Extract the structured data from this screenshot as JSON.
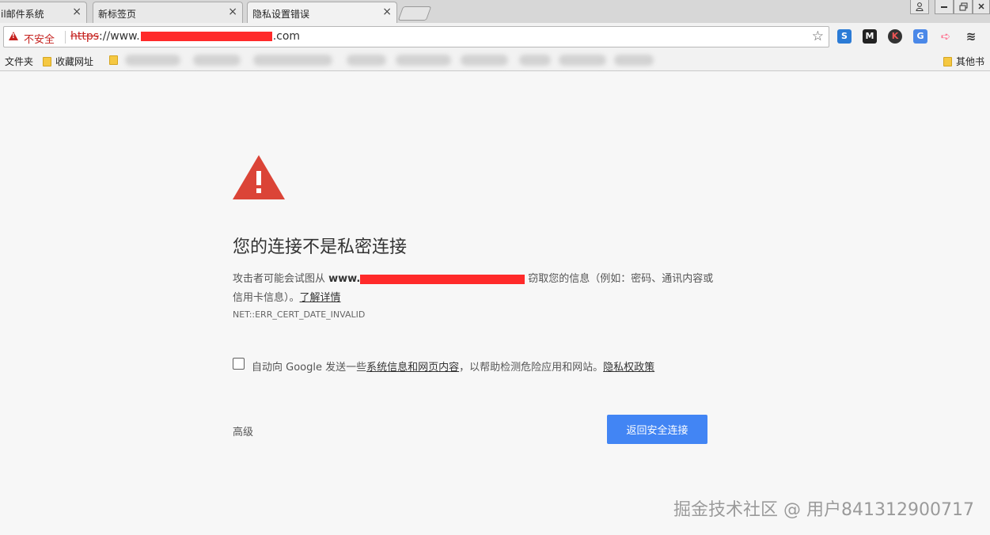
{
  "tabs": [
    {
      "title": "il邮件系统"
    },
    {
      "title": "新标签页"
    },
    {
      "title": "隐私设置错误"
    }
  ],
  "close_glyph": "×",
  "address_bar": {
    "security_label": "不安全",
    "url_scheme": "https",
    "url_prefix": "://www.",
    "url_suffix": ".com"
  },
  "bookmarks": {
    "items": [
      "文件夹",
      "收藏网址"
    ],
    "other": "其他书"
  },
  "interstitial": {
    "heading": "您的连接不是私密连接",
    "desc_prefix": "攻击者可能会试图从 ",
    "desc_domain": "www.",
    "desc_suffix": "窃取您的信息（例如：密码、通讯内容或信用卡信息）。",
    "learn_more": "了解详情",
    "error_code": "NET::ERR_CERT_DATE_INVALID",
    "checkbox_prefix": "自动向 Google 发送一些",
    "checkbox_link": "系统信息和网页内容",
    "checkbox_middle": "，以帮助检测危险应用和网站。",
    "privacy_link": "隐私权政策",
    "advanced": "高级",
    "back_button": "返回安全连接"
  },
  "watermark": "掘金技术社区 @ 用户841312900717",
  "colors": {
    "danger": "#c5221f",
    "warning_icon": "#db4437",
    "primary_button": "#4285f4",
    "redaction": "#ff2a2a"
  },
  "icons": [
    "warning-triangle-icon",
    "not-secure-icon",
    "star-icon",
    "folder-icon",
    "user-icon",
    "minimize-icon",
    "restore-icon",
    "close-icon"
  ]
}
